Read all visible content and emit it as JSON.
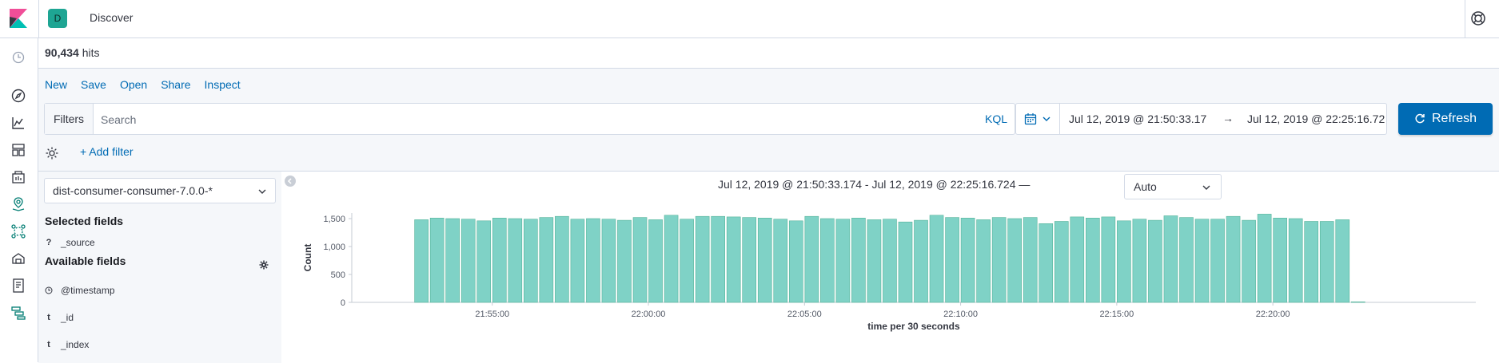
{
  "app": {
    "title": "Discover",
    "space_initial": "D"
  },
  "hits": {
    "count": "90,434",
    "label": "hits"
  },
  "menu": {
    "new": "New",
    "save": "Save",
    "open": "Open",
    "share": "Share",
    "inspect": "Inspect"
  },
  "query": {
    "filters_label": "Filters",
    "placeholder": "Search",
    "language": "KQL"
  },
  "date": {
    "start": "Jul 12, 2019 @ 21:50:33.17",
    "arrow": "→",
    "end": "Jul 12, 2019 @ 22:25:16.72"
  },
  "refresh_label": "Refresh",
  "add_filter_label": "+ Add filter",
  "sidebar": {
    "index_pattern": "dist-consumer-consumer-7.0.0-*",
    "selected_title": "Selected fields",
    "selected_fields": [
      {
        "type": "?",
        "name": "_source"
      }
    ],
    "available_title": "Available fields",
    "available_fields": [
      {
        "type": "clock",
        "name": "@timestamp"
      },
      {
        "type": "t",
        "name": "_id"
      },
      {
        "type": "t",
        "name": "_index"
      }
    ]
  },
  "histogram": {
    "range_label": "Jul 12, 2019 @ 21:50:33.174 - Jul 12, 2019 @ 22:25:16.724 —",
    "interval": "Auto"
  },
  "colors": {
    "accent": "#006bb4",
    "bar": "#7fd2c6",
    "bar_stroke": "#54b399"
  },
  "chart_data": {
    "type": "bar",
    "xlabel": "time per 30 seconds",
    "ylabel": "Count",
    "ylim": [
      0,
      1600
    ],
    "yticks": [
      0,
      500,
      1000,
      1500
    ],
    "ytick_labels": [
      "0",
      "500",
      "1,000",
      "1,500"
    ],
    "xlim": [
      "21:50:30",
      "22:26:30"
    ],
    "xticks": [
      "21:55:00",
      "22:00:00",
      "22:05:00",
      "22:10:00",
      "22:15:00",
      "22:20:00"
    ],
    "x_start": "21:52:30",
    "bar_interval_seconds": 30,
    "values": [
      1480,
      1510,
      1500,
      1490,
      1460,
      1510,
      1500,
      1490,
      1520,
      1540,
      1490,
      1500,
      1490,
      1470,
      1520,
      1480,
      1560,
      1490,
      1540,
      1540,
      1530,
      1520,
      1510,
      1490,
      1460,
      1540,
      1500,
      1490,
      1510,
      1480,
      1490,
      1440,
      1470,
      1560,
      1520,
      1510,
      1480,
      1520,
      1500,
      1520,
      1410,
      1450,
      1530,
      1510,
      1530,
      1460,
      1490,
      1470,
      1550,
      1520,
      1490,
      1490,
      1540,
      1470,
      1580,
      1510,
      1500,
      1450,
      1450,
      1480,
      10
    ],
    "grid": false,
    "legend": "none"
  }
}
